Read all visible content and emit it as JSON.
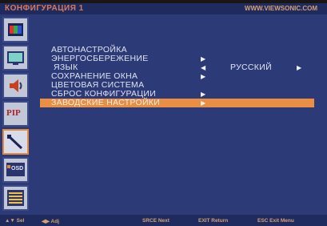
{
  "window": {
    "title": "КОНФИГУРАЦИЯ 1",
    "brand_url": "WWW.VIEWSONIC.COM"
  },
  "sidebar": {
    "items": [
      {
        "icon": "color-bars-icon"
      },
      {
        "icon": "display-panel-icon"
      },
      {
        "icon": "speaker-icon"
      },
      {
        "icon": "pip-icon",
        "label": "PIP"
      },
      {
        "icon": "tools-icon"
      },
      {
        "icon": "osd-icon",
        "label": "OSD"
      },
      {
        "icon": "menu-list-icon"
      }
    ]
  },
  "menu": {
    "items": [
      {
        "label": "АВТОНАСТРОЙКА",
        "arrow": ""
      },
      {
        "label": "ЭНЕРГОСБЕРЕЖЕНИЕ",
        "arrow": "▶"
      },
      {
        "label": "ЯЗЫК",
        "arrow": "◀"
      },
      {
        "label": "СОХРАНЕНИЕ ОКНА",
        "arrow": "▶"
      },
      {
        "label": "ЦВЕТОВАЯ СИСТЕМА",
        "arrow": ""
      },
      {
        "label": "СБРОС КОНФИГУРАЦИИ",
        "arrow": "▶"
      },
      {
        "label": "ЗАВОДСКИЕ НАСТРОЙКИ",
        "arrow": "▶"
      }
    ],
    "selected_index": 6,
    "language_value": "РУССКИЙ",
    "language_arrow": "▶"
  },
  "footer": {
    "sel": "▲▼ Sel",
    "adj": "◀▶ Adj",
    "next": "SRCE Next",
    "return": "EXIT Return",
    "exit": "ESC Exit Menu"
  },
  "colors": {
    "panel": "#2c3b78",
    "titlebar": "#1f2b5e",
    "highlight": "#e98e43",
    "title_text": "#d87a5a"
  }
}
